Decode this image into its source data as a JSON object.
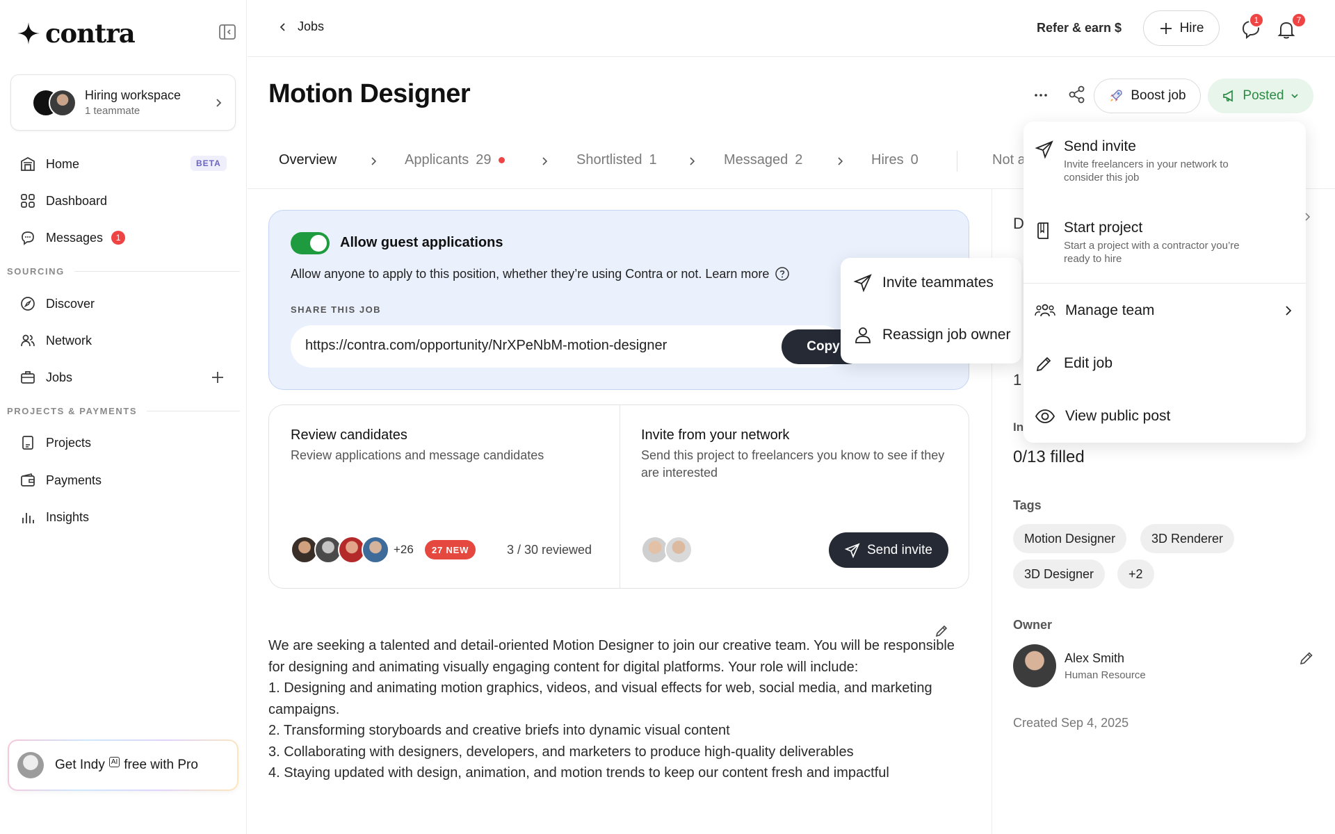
{
  "app": {
    "logo_text": "contra"
  },
  "sidebar": {
    "workspace": {
      "title": "Hiring workspace",
      "subtitle": "1 teammate"
    },
    "items": [
      {
        "label": "Home",
        "badge": "BETA"
      },
      {
        "label": "Dashboard"
      },
      {
        "label": "Messages",
        "badge_count": "1"
      },
      {
        "label": "Discover"
      },
      {
        "label": "Network"
      },
      {
        "label": "Jobs"
      },
      {
        "label": "Projects"
      },
      {
        "label": "Payments"
      },
      {
        "label": "Insights"
      }
    ],
    "sections": {
      "sourcing": "SOURCING",
      "projects_payments": "PROJECTS & PAYMENTS"
    },
    "indy": {
      "prefix": "Get Indy",
      "ai_tag": "AI",
      "suffix": "free with Pro"
    }
  },
  "topbar": {
    "back_label": "Jobs",
    "refer_label": "Refer & earn $",
    "hire_label": "Hire",
    "messages_badge": "1",
    "notifications_badge": "7"
  },
  "job": {
    "title": "Motion Designer",
    "boost_label": "Boost job",
    "status_label": "Posted"
  },
  "tabs": [
    {
      "label": "Overview",
      "count": ""
    },
    {
      "label": "Applicants",
      "count": "29"
    },
    {
      "label": "Shortlisted",
      "count": "1"
    },
    {
      "label": "Messaged",
      "count": "2"
    },
    {
      "label": "Hires",
      "count": "0"
    },
    {
      "label": "Not a",
      "count": ""
    }
  ],
  "guest": {
    "title": "Allow guest applications",
    "enabled": true,
    "description": "Allow anyone to apply to this position, whether they’re using Contra or not. Learn more",
    "share_label": "SHARE THIS JOB",
    "url": "https://contra.com/opportunity/NrXPeNbM-motion-designer",
    "copy_label": "Copy"
  },
  "review": {
    "title": "Review candidates",
    "subtitle": "Review applications and message candidates",
    "more_count": "+26",
    "new_label": "27 NEW",
    "reviewed": "3 / 30 reviewed"
  },
  "invite": {
    "title": "Invite from your network",
    "subtitle": "Send this project to freelancers you know to see if they are interested",
    "button": "Send invite"
  },
  "description_lines": [
    "We are seeking a talented and detail-oriented Motion Designer to join our creative team. You will be responsible for designing and animating visually engaging content for digital platforms. Your role will include:",
    "1. Designing and animating motion graphics, videos, and visual effects for web, social media, and marketing campaigns.",
    "2. Transforming storyboards and creative briefs into dynamic visual content",
    "3. Collaborating with designers, developers, and marketers to produce high-quality deliverables",
    "4. Staying updated with design, animation, and motion trends to keep our content fresh and impactful"
  ],
  "right_panel": {
    "peek_d": "D",
    "peek_1": "1",
    "peek_in": "In",
    "filled": "0/13 filled",
    "tags_label": "Tags",
    "tags": [
      "Motion Designer",
      "3D Renderer",
      "3D Designer",
      "+2"
    ],
    "owner_label": "Owner",
    "owner_name": "Alex Smith",
    "owner_role": "Human Resource",
    "created": "Created Sep 4, 2025"
  },
  "menu_small": {
    "items": [
      {
        "label": "Invite teammates"
      },
      {
        "label": "Reassign job owner"
      }
    ]
  },
  "menu_big": {
    "items": [
      {
        "title": "Send invite",
        "subtitle": "Invite freelancers in your network to consider this job"
      },
      {
        "title": "Start project",
        "subtitle": "Start a project with a contractor you’re ready to hire"
      },
      {
        "title": "Manage team"
      },
      {
        "title": "Edit job"
      },
      {
        "title": "View public post"
      }
    ]
  },
  "colors": {
    "accent_dark": "#252a35",
    "success": "#1f9b3f",
    "danger": "#ef4444",
    "info_bg": "#eaf1fd"
  }
}
